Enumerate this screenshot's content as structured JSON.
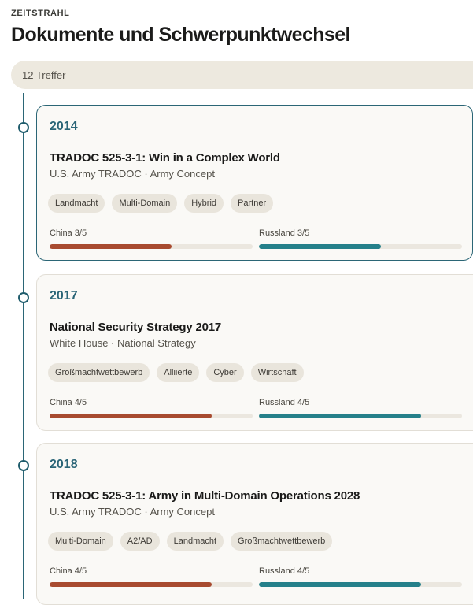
{
  "header": {
    "eyebrow": "ZEITSTRAHL",
    "title": "Dokumente und Schwerpunktwechsel"
  },
  "filter": {
    "result_count": "12 Treffer"
  },
  "colors": {
    "accent": "#2a6577",
    "china": "#a84b30",
    "russia": "#25808a"
  },
  "entries": [
    {
      "year": "2014",
      "title": "TRADOC 525-3-1: Win in a Complex World",
      "subtitle": "U.S. Army TRADOC · Army Concept",
      "tags": [
        "Landmacht",
        "Multi-Domain",
        "Hybrid",
        "Partner"
      ],
      "china_label": "China 3/5",
      "china_score": 3,
      "russia_label": "Russland 3/5",
      "russia_score": 3,
      "max_score": 5,
      "selected": true
    },
    {
      "year": "2017",
      "title": "National Security Strategy 2017",
      "subtitle": "White House · National Strategy",
      "tags": [
        "Großmachtwettbewerb",
        "Alliierte",
        "Cyber",
        "Wirtschaft"
      ],
      "china_label": "China 4/5",
      "china_score": 4,
      "russia_label": "Russland 4/5",
      "russia_score": 4,
      "max_score": 5,
      "selected": false
    },
    {
      "year": "2018",
      "title": "TRADOC 525-3-1: Army in Multi-Domain Operations 2028",
      "subtitle": "U.S. Army TRADOC · Army Concept",
      "tags": [
        "Multi-Domain",
        "A2/AD",
        "Landmacht",
        "Großmachtwettbewerb"
      ],
      "china_label": "China 4/5",
      "china_score": 4,
      "russia_label": "Russland 4/5",
      "russia_score": 4,
      "max_score": 5,
      "selected": false
    }
  ]
}
